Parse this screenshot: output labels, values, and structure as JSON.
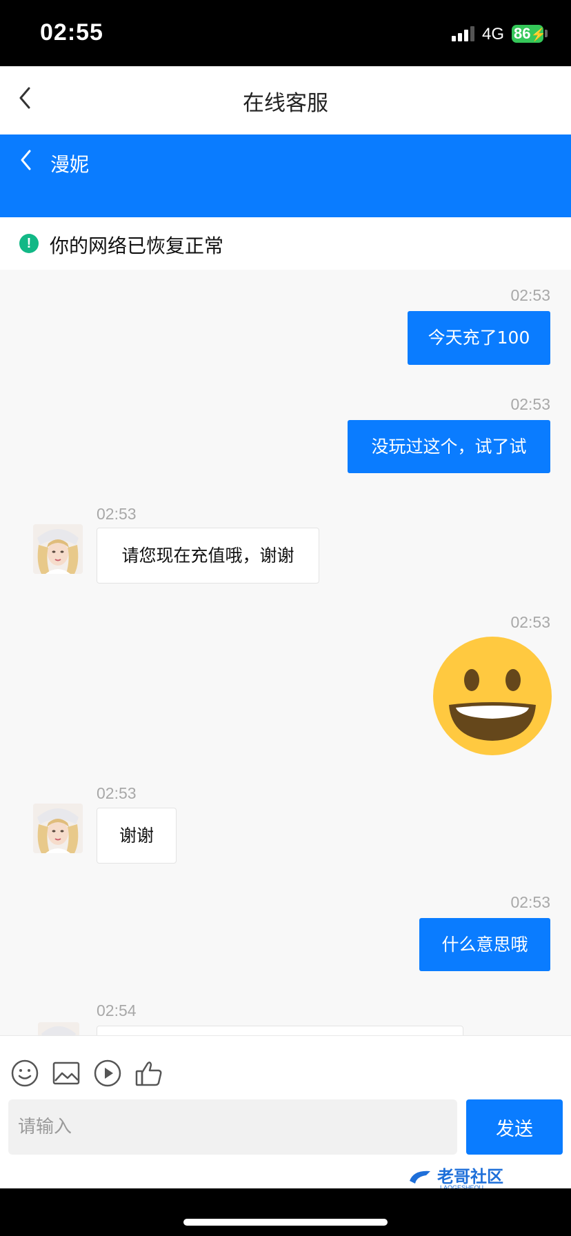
{
  "status_bar": {
    "time": "02:55",
    "network": "4G",
    "battery": "86"
  },
  "header": {
    "title": "在线客服"
  },
  "agent": {
    "name": "漫妮"
  },
  "notice": {
    "text": "你的网络已恢复正常",
    "icon": "exclamation-icon"
  },
  "messages": [
    {
      "side": "out",
      "time": "02:53",
      "text": "今天充了100"
    },
    {
      "side": "out",
      "time": "02:53",
      "text": "没玩过这个，试了试"
    },
    {
      "side": "in",
      "time": "02:53",
      "text": "请您现在充值哦，谢谢"
    },
    {
      "side": "out",
      "time": "02:53",
      "emoji": "grinning-face"
    },
    {
      "side": "in",
      "time": "02:53",
      "text": "谢谢"
    },
    {
      "side": "out",
      "time": "02:53",
      "text": "什么意思哦"
    },
    {
      "side": "in",
      "time": "02:54",
      "text": ""
    }
  ],
  "toolbar": {
    "icons": [
      "smiley-icon",
      "image-icon",
      "video-play-icon",
      "thumbs-up-icon"
    ]
  },
  "input": {
    "placeholder": "请输入",
    "value": ""
  },
  "send_label": "发送",
  "watermark": {
    "text": "老哥社区",
    "subtext": "LAOGESHEQU"
  },
  "colors": {
    "accent": "#0a7cff",
    "notice_icon": "#12b886",
    "battery": "#35c759"
  }
}
